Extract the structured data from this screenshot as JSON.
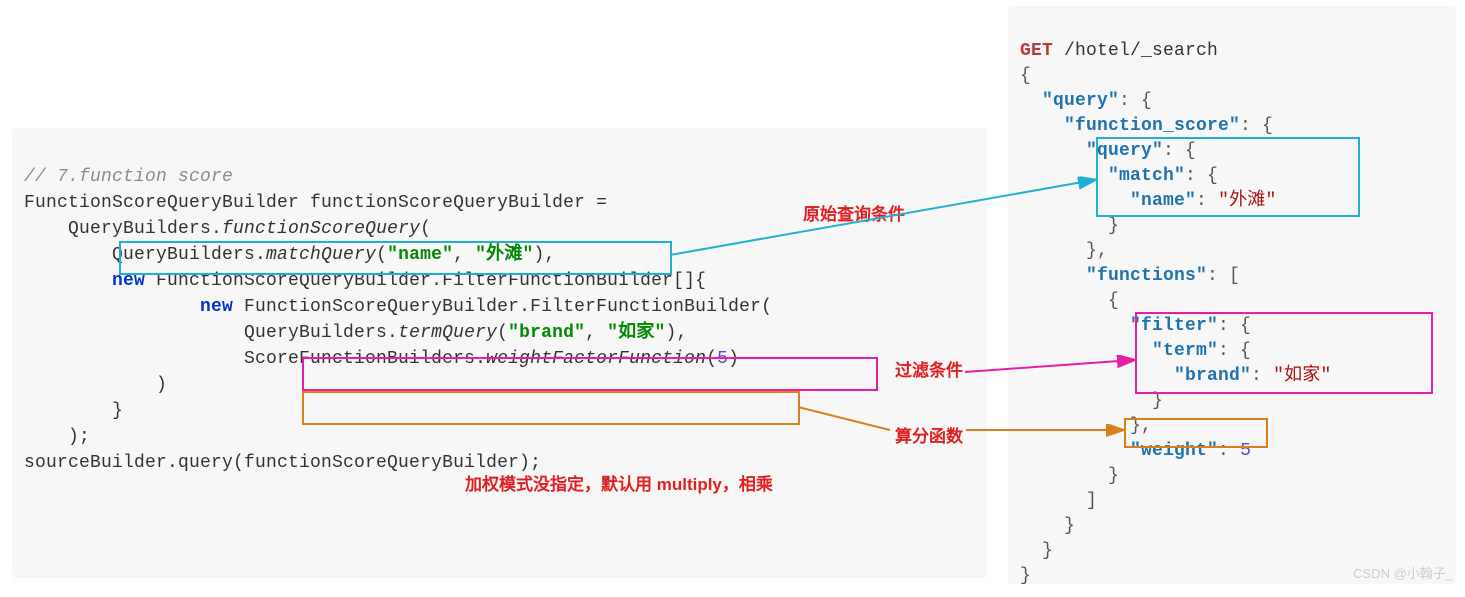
{
  "left": {
    "comment": "// 7.function score",
    "l1": "FunctionScoreQueryBuilder functionScoreQueryBuilder =",
    "l2a": "    QueryBuilders.",
    "l2b": "functionScoreQuery",
    "l2c": "(",
    "l3a": "        QueryBuilders.",
    "l3b": "matchQuery",
    "l3c": "(",
    "l3d": "\"name\"",
    "l3e": ", ",
    "l3f": "\"外滩\"",
    "l3g": "),",
    "l4a": "        ",
    "l4b": "new",
    "l4c": " FunctionScoreQueryBuilder.FilterFunctionBuilder[]{",
    "l5a": "                ",
    "l5b": "new",
    "l5c": " FunctionScoreQueryBuilder.FilterFunctionBuilder(",
    "l6a": "                    QueryBuilders.",
    "l6b": "termQuery",
    "l6c": "(",
    "l6d": "\"brand\"",
    "l6e": ", ",
    "l6f": "\"如家\"",
    "l6g": "),",
    "l7a": "                    ScoreFunctionBuilders.",
    "l7b": "weightFactorFunction",
    "l7c": "(",
    "l7d": "5",
    "l7e": ")",
    "l8": "            )",
    "l9": "        }",
    "l10": "    );",
    "l11": "sourceBuilder.query(functionScoreQueryBuilder);"
  },
  "right": {
    "l1a": "GET",
    "l1b": " /hotel/_search",
    "l2": "{",
    "l3a": "  ",
    "l3b": "\"query\"",
    "l3c": ": {",
    "l4a": "    ",
    "l4b": "\"function_score\"",
    "l4c": ": {",
    "l5a": "      ",
    "l5b": "\"query\"",
    "l5c": ": {",
    "l6a": "        ",
    "l6b": "\"match\"",
    "l6c": ": {",
    "l7a": "          ",
    "l7b": "\"name\"",
    "l7c": ": ",
    "l7d": "\"外滩\"",
    "l8": "        }",
    "l9": "      },",
    "l10a": "      ",
    "l10b": "\"functions\"",
    "l10c": ": [",
    "l11": "        {",
    "l12a": "          ",
    "l12b": "\"filter\"",
    "l12c": ": {",
    "l13a": "            ",
    "l13b": "\"term\"",
    "l13c": ": {",
    "l14a": "              ",
    "l14b": "\"brand\"",
    "l14c": ": ",
    "l14d": "\"如家\"",
    "l15": "            }",
    "l16": "          },",
    "l17a": "          ",
    "l17b": "\"weight\"",
    "l17c": ": ",
    "l17d": "5",
    "l18": "        }",
    "l19": "      ]",
    "l20": "    }",
    "l21": "  }",
    "l22": "}"
  },
  "anno": {
    "a1": "原始查询条件",
    "a2": "过滤条件",
    "a3": "算分函数",
    "a4": "加权模式没指定，默认用 multiply，相乘"
  },
  "watermark": "CSDN @小翰子_"
}
